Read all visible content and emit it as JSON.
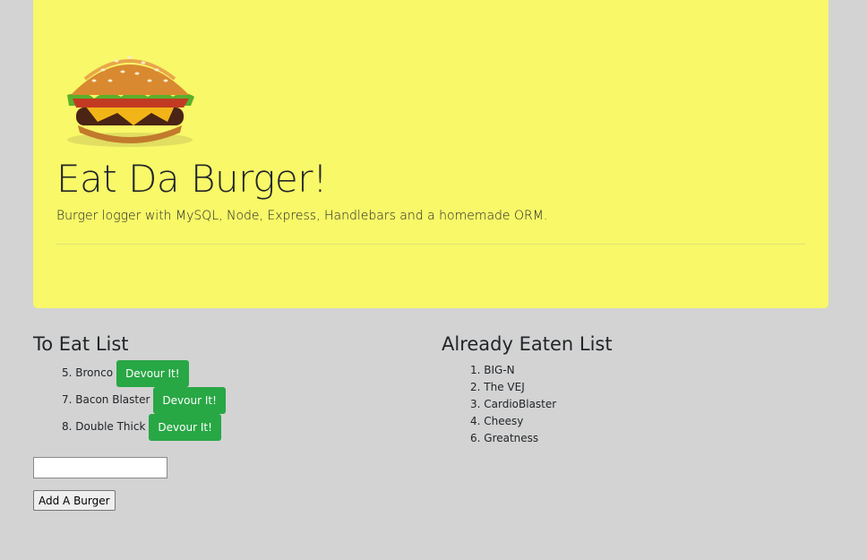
{
  "header": {
    "title": "Eat Da Burger!",
    "subtitle": "Burger logger with MySQL, Node, Express, Handlebars and a homemade ORM."
  },
  "to_eat": {
    "heading": "To Eat List",
    "button_label": "Devour It!",
    "items": [
      {
        "text": "5. Bronco"
      },
      {
        "text": "7. Bacon Blaster"
      },
      {
        "text": "8. Double Thick"
      }
    ]
  },
  "eaten": {
    "heading": "Already Eaten List",
    "items": [
      {
        "text": "1. BIG-N"
      },
      {
        "text": "2. The VEJ"
      },
      {
        "text": "3. CardioBlaster"
      },
      {
        "text": "4. Cheesy"
      },
      {
        "text": "6. Greatness"
      }
    ]
  },
  "form": {
    "input_value": "",
    "add_label": "Add A Burger"
  },
  "colors": {
    "background": "#d3d3d3",
    "jumbotron": "#f8f868",
    "button": "#28a745"
  }
}
